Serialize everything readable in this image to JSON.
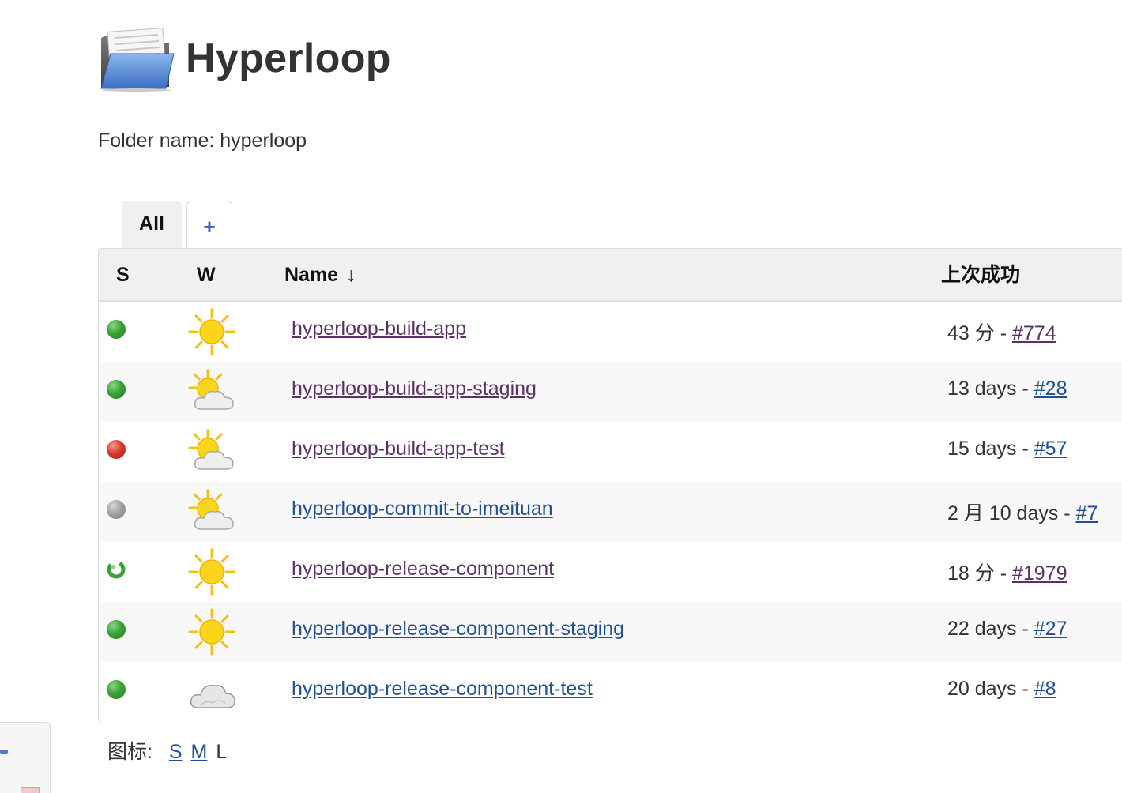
{
  "header": {
    "title": "Hyperloop",
    "folder_icon": "open-folder-icon",
    "folder_name_label": "Folder name: hyperloop"
  },
  "tabs": {
    "all_label": "All",
    "add_label": "+"
  },
  "table": {
    "columns": {
      "status": "S",
      "weather": "W",
      "name": "Name",
      "name_sort_indicator": "↓",
      "last_success": "上次成功"
    },
    "rows": [
      {
        "status": "blue",
        "weather": "sunny-icon",
        "name": "hyperloop-build-app",
        "last_success_text": "43 分 - ",
        "build": "#774",
        "name_visited": true,
        "build_visited": true
      },
      {
        "status": "blue",
        "weather": "partly-cloudy-icon",
        "name": "hyperloop-build-app-staging",
        "last_success_text": "13 days - ",
        "build": "#28",
        "name_visited": true,
        "build_visited": false
      },
      {
        "status": "red",
        "weather": "partly-cloudy-icon",
        "name": "hyperloop-build-app-test",
        "last_success_text": "15 days - ",
        "build": "#57",
        "name_visited": true,
        "build_visited": false
      },
      {
        "status": "grey",
        "weather": "partly-cloudy-icon",
        "name": "hyperloop-commit-to-imeituan",
        "last_success_text": "2 月 10 days - ",
        "build": "#7",
        "name_visited": false,
        "build_visited": false
      },
      {
        "status": "blue-anime",
        "weather": "sunny-icon",
        "name": "hyperloop-release-component",
        "last_success_text": "18 分 - ",
        "build": "#1979",
        "name_visited": true,
        "build_visited": true
      },
      {
        "status": "blue",
        "weather": "sunny-icon",
        "name": "hyperloop-release-component-staging",
        "last_success_text": "22 days - ",
        "build": "#27",
        "name_visited": false,
        "build_visited": false
      },
      {
        "status": "blue",
        "weather": "cloudy-icon",
        "name": "hyperloop-release-component-test",
        "last_success_text": "20 days - ",
        "build": "#8",
        "name_visited": false,
        "build_visited": false
      }
    ]
  },
  "icon_size": {
    "label": "图标:",
    "small": "S",
    "medium": "M",
    "large": "L"
  },
  "colors": {
    "link": "#1f4f94",
    "visited_link": "#5c2f67",
    "status_blue": "#3aa238",
    "status_red": "#d8382e",
    "status_grey": "#a2a2a2"
  }
}
